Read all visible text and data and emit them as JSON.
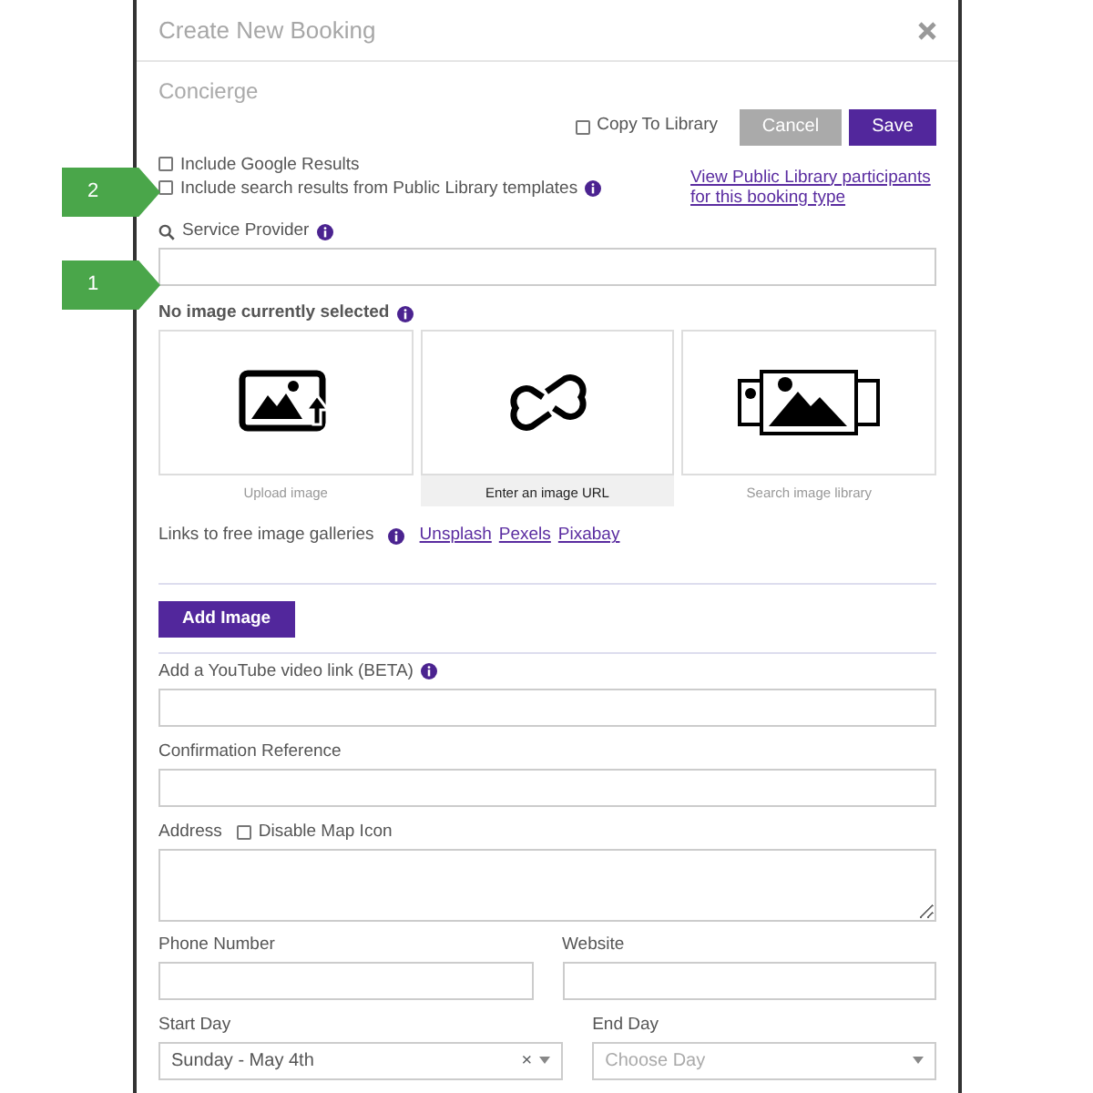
{
  "callouts": [
    {
      "label": "2"
    },
    {
      "label": "1"
    }
  ],
  "modal": {
    "title": "Create New Booking",
    "subtitle": "Concierge"
  },
  "copy_to_library": {
    "label": "Copy To Library",
    "checked": false
  },
  "buttons": [
    {
      "label": "Cancel",
      "kind": "secondary"
    },
    {
      "label": "Save",
      "kind": "primary"
    }
  ],
  "search_options": [
    {
      "label": "Include Google Results",
      "checked": false,
      "info": false
    },
    {
      "label": "Include search results from Public Library templates",
      "checked": false,
      "info": true
    }
  ],
  "participants_link": "View Public Library participants for this booking type",
  "service_provider": {
    "label": "Service Provider"
  },
  "image_section": {
    "label": "No image currently selected",
    "options": [
      {
        "kind": "upload",
        "caption": "Upload image",
        "selected": false
      },
      {
        "kind": "link",
        "caption": "Enter an image URL",
        "selected": true
      },
      {
        "kind": "library",
        "caption": "Search image library",
        "selected": false
      }
    ],
    "galleries_label": "Links to free image galleries",
    "galleries": [
      "Unsplash",
      "Pexels",
      "Pixabay"
    ],
    "add_button": "Add Image"
  },
  "youtube": {
    "label": "Add a YouTube video link (BETA)"
  },
  "confirmation": {
    "label": "Confirmation Reference"
  },
  "address": {
    "label": "Address",
    "disable_map": {
      "label": "Disable Map Icon",
      "checked": false
    }
  },
  "phone": {
    "label": "Phone Number"
  },
  "website": {
    "label": "Website"
  },
  "start_day": {
    "label": "Start Day",
    "value": "Sunday - May 4th",
    "clear": "×"
  },
  "end_day": {
    "label": "End Day",
    "placeholder": "Choose Day"
  }
}
